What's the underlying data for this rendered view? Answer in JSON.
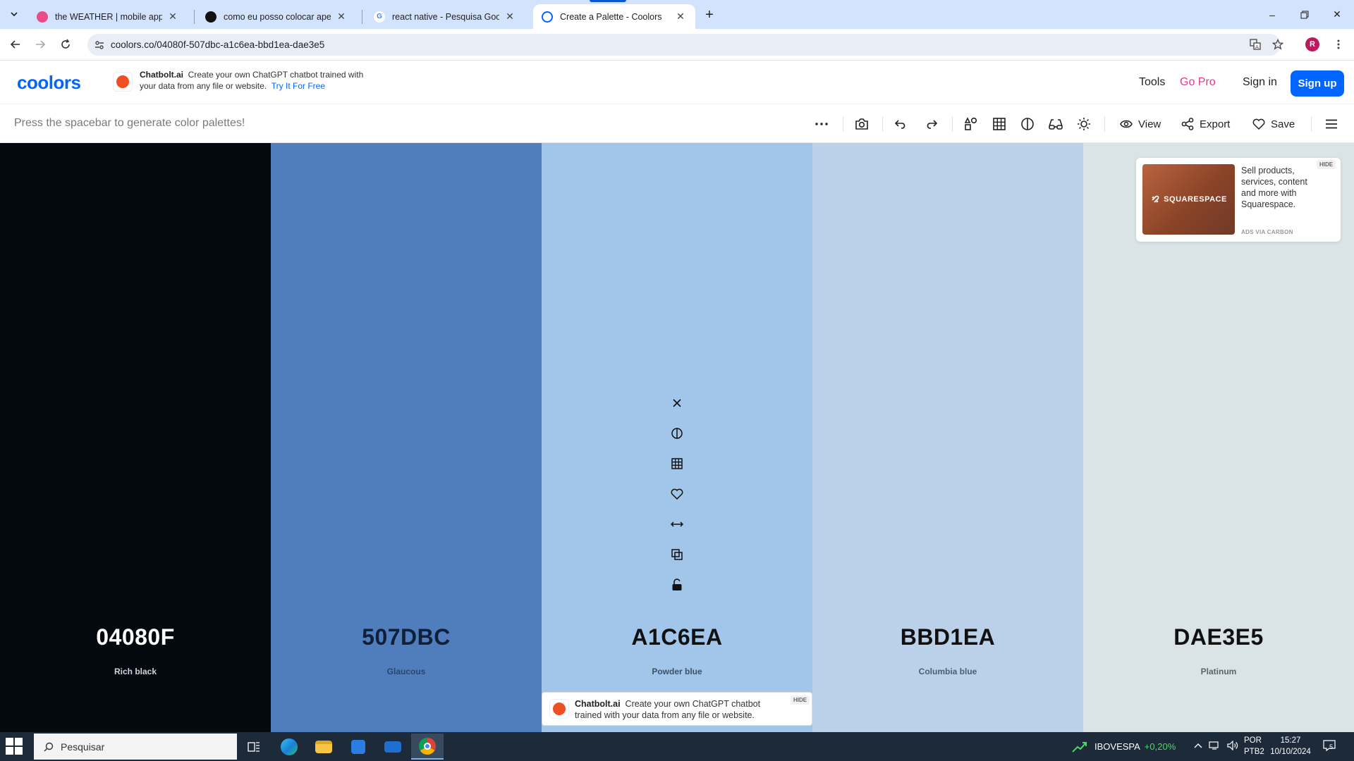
{
  "browser": {
    "tabs": [
      {
        "title": "the WEATHER | mobile app by J",
        "favicon_color": "#ea4c89"
      },
      {
        "title": "como eu posso colocar apenas",
        "favicon_color": "#111111"
      },
      {
        "title": "react native - Pesquisa Google",
        "favicon_color": "#4285f4"
      },
      {
        "title": "Create a Palette - Coolors",
        "favicon_color": "#0066ff"
      }
    ],
    "url": "coolors.co/04080f-507dbc-a1c6ea-bbd1ea-dae3e5",
    "profile_initial": "R"
  },
  "header": {
    "logo": "coolors",
    "promo": {
      "brand": "Chatbolt.ai",
      "text": "Create your own ChatGPT chatbot trained with your data from any file or website.",
      "cta": "Try It For Free"
    },
    "nav": {
      "tools": "Tools",
      "go_pro": "Go Pro",
      "sign_in": "Sign in",
      "sign_up": "Sign up"
    }
  },
  "toolbar": {
    "hint": "Press the spacebar to generate color palettes!",
    "view_label": "View",
    "export_label": "Export",
    "save_label": "Save"
  },
  "palette": [
    {
      "hex": "04080F",
      "name": "Rich black",
      "color": "#04080f",
      "text_color": "#ffffff",
      "name_color": "#cfd3da"
    },
    {
      "hex": "507DBC",
      "name": "Glaucous",
      "color": "#507dbc",
      "text_color": "#10203a",
      "name_color": "#2a4670"
    },
    {
      "hex": "A1C6EA",
      "name": "Powder blue",
      "color": "#a1c6ea",
      "text_color": "#111111",
      "name_color": "#3c5066"
    },
    {
      "hex": "BBD1EA",
      "name": "Columbia blue",
      "color": "#bbd1ea",
      "text_color": "#111111",
      "name_color": "#4d5e72"
    },
    {
      "hex": "DAE3E5",
      "name": "Platinum",
      "color": "#dae3e5",
      "text_color": "#111111",
      "name_color": "#5b6466"
    }
  ],
  "side_ad": {
    "brand": "SQUARESPACE",
    "text": "Sell products, services, content and more with Squarespace.",
    "via": "ADS VIA CARBON",
    "hide": "HIDE"
  },
  "bottom_ad": {
    "brand": "Chatbolt.ai",
    "text": "Create your own ChatGPT chatbot trained with your data from any file or website.",
    "hide": "HIDE"
  },
  "taskbar": {
    "search_placeholder": "Pesquisar",
    "ticker_name": "IBOVESPA",
    "ticker_change": "+0,20%",
    "lang_1": "POR",
    "lang_2": "PTB2",
    "time": "15:27",
    "date": "10/10/2024",
    "notifications": "5"
  }
}
